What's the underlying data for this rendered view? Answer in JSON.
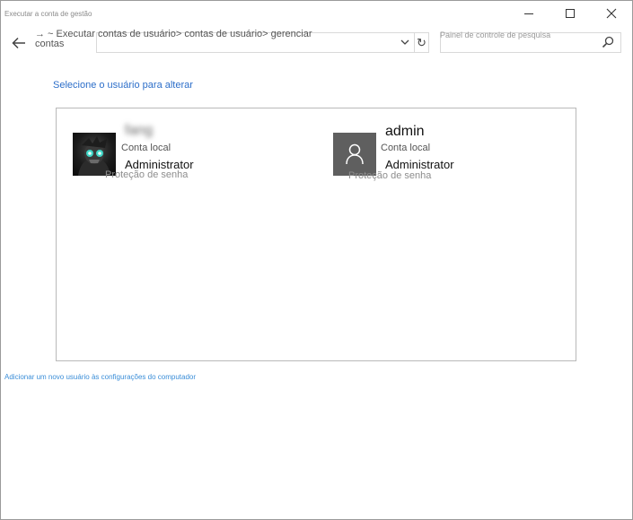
{
  "window": {
    "title": "Executar a conta de gestão"
  },
  "nav": {
    "address_path": "→ ~ Executar contas de usuário> contas de usuário> gerenciar contas",
    "search_placeholder": "Painel de controle de pesquisa"
  },
  "main": {
    "section_link": "Selecione o usuário para alterar",
    "users": [
      {
        "name": "fang",
        "type": "Conta local",
        "role": "Administrator",
        "protection": "Proteção de senha",
        "avatar": "photo-avatar"
      },
      {
        "name": "admin",
        "type": "Conta local",
        "role": "Administrator",
        "protection": "Proteção de senha",
        "avatar": "generic-user-icon"
      }
    ],
    "footer_link": "Adicionar um novo usuário às configurações do computador"
  },
  "colors": {
    "link": "#2c6ec9",
    "footer_link": "#3b8ed8",
    "generic_avatar_bg": "#5f5f5f"
  }
}
